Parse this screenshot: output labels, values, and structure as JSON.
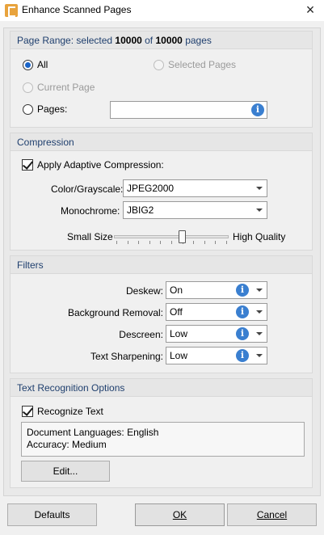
{
  "window": {
    "title": "Enhance Scanned Pages",
    "close_glyph": "×"
  },
  "page_range": {
    "header_prefix": "Page Range: selected ",
    "selected": "10000",
    "header_mid": " of ",
    "total": "10000",
    "header_suffix": " pages",
    "all_label": "All",
    "selected_pages_label": "Selected Pages",
    "current_page_label": "Current Page",
    "pages_label": "Pages:",
    "pages_value": ""
  },
  "compression": {
    "header": "Compression",
    "adaptive_label": "Apply Adaptive Compression:",
    "color_label": "Color/Grayscale:",
    "color_value": "JPEG2000",
    "mono_label": "Monochrome:",
    "mono_value": "JBIG2",
    "small_label": "Small Size",
    "quality_label": "High Quality",
    "slider_fraction": 0.6
  },
  "filters": {
    "header": "Filters",
    "rows": [
      {
        "label": "Deskew:",
        "value": "On"
      },
      {
        "label": "Background Removal:",
        "value": "Off"
      },
      {
        "label": "Descreen:",
        "value": "Low"
      },
      {
        "label": "Text Sharpening:",
        "value": "Low"
      }
    ]
  },
  "ocr": {
    "header": "Text Recognition Options",
    "recognize_label": "Recognize Text",
    "languages": "Document Languages: English",
    "accuracy": "Accuracy: Medium",
    "edit_label": "Edit..."
  },
  "footer": {
    "defaults": "Defaults",
    "ok": "OK",
    "cancel": "Cancel"
  },
  "icons": {
    "info": "i"
  }
}
